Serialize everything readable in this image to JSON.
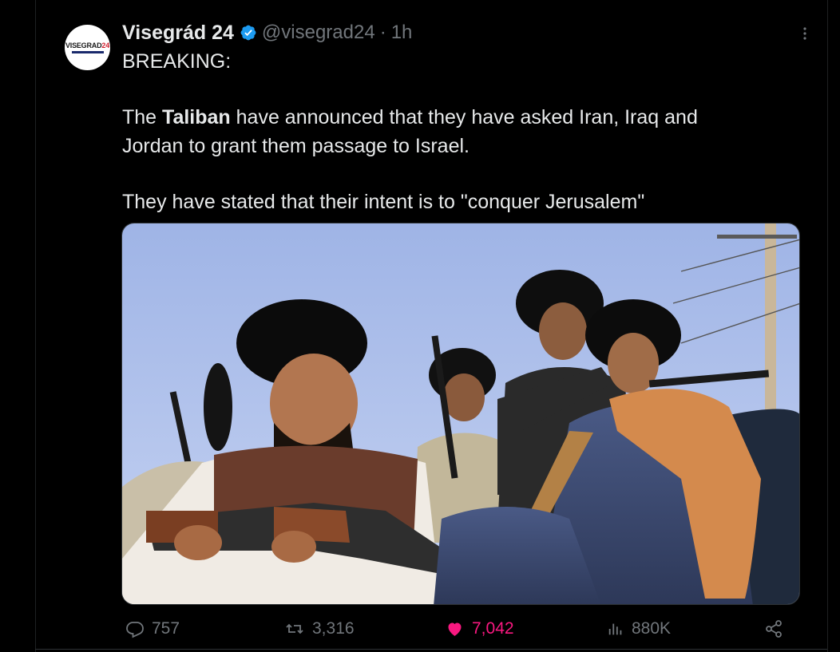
{
  "tweet": {
    "author": {
      "display_name": "Visegrád 24",
      "handle": "@visegrad24",
      "separator": "·",
      "time": "1h",
      "avatar_text_main": "VISEGRAD",
      "avatar_text_accent": "24",
      "verified_icon": "verified-badge-icon"
    },
    "body": {
      "line1": "BREAKING:",
      "line2_pre": "The ",
      "line2_bold": "Taliban",
      "line2_post": " have announced that they have asked Iran, Iraq and",
      "line3": "Jordan to grant them passage to Israel.",
      "line4": "They have stated that their intent is to \"conquer Jerusalem\""
    },
    "media": {
      "type": "photo",
      "description_icon": "photo"
    },
    "actions": {
      "replies": "757",
      "retweets": "3,316",
      "likes": "7,042",
      "views": "880K",
      "reply_icon": "reply-icon",
      "retweet_icon": "retweet-icon",
      "like_icon": "heart-icon",
      "views_icon": "analytics-icon",
      "share_icon": "share-icon"
    },
    "colors": {
      "background": "#000000",
      "text": "#e7e9ea",
      "muted": "#71767b",
      "verified": "#1d9bf0",
      "like": "#f91880"
    }
  }
}
